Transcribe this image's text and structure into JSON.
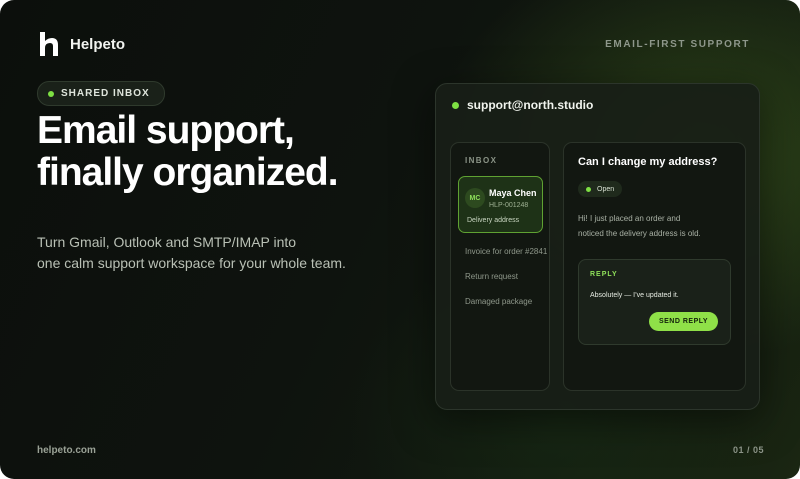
{
  "brand": {
    "name": "Helpeto",
    "tagline": "EMAIL-FIRST SUPPORT"
  },
  "hero": {
    "pill_label": "SHARED INBOX",
    "headline": [
      "Email support,",
      "finally organized."
    ],
    "subtitle": [
      "Turn Gmail, Outlook and SMTP/IMAP into",
      "one calm support workspace for your whole team."
    ]
  },
  "app": {
    "account": "support@north.studio",
    "inbox": {
      "label": "INBOX",
      "active": {
        "initials": "MC",
        "name": "Maya Chen",
        "ticket_id": "HLP-001248",
        "subject": "Delivery address"
      },
      "items": [
        "Invoice for order #2841",
        "Return request",
        "Damaged package"
      ]
    },
    "thread": {
      "title": "Can I change my address?",
      "status": "Open",
      "message": [
        "Hi! I just placed an order and",
        "noticed the delivery address is old."
      ],
      "reply_label": "REPLY",
      "reply_text": "Absolutely — I’ve updated it.",
      "send_label": "SEND REPLY"
    }
  },
  "footer": {
    "url": "helpeto.com",
    "page": "01 / 05"
  },
  "colors": {
    "accent": "#7ee043",
    "background": "#0c0f0c",
    "panel": "#121711"
  }
}
